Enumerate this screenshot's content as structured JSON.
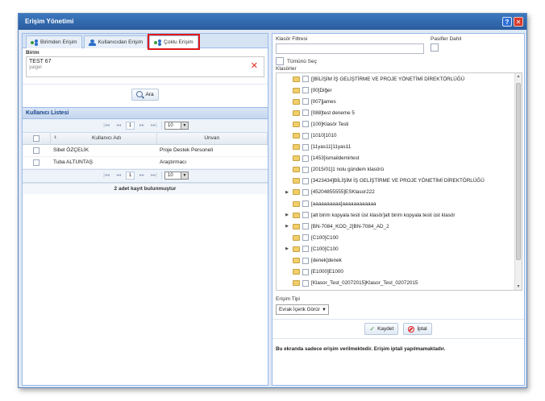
{
  "window": {
    "title": "Erişim Yönetimi"
  },
  "tabs": [
    {
      "label": "Birimden Erişim"
    },
    {
      "label": "Kullanıcıdan Erişim"
    },
    {
      "label": "Çoklu Erişim"
    }
  ],
  "birim": {
    "label": "Birim",
    "name": "TEST 67",
    "sub": "yaigel"
  },
  "search_button": {
    "label": "Ara"
  },
  "user_grid": {
    "title": "Kullanıcı Listesi",
    "page": "1",
    "page_size": "10",
    "columns": [
      "Kullanıcı Adı",
      "Unvan"
    ],
    "rows": [
      {
        "name": "Sibel ÖZÇELİK",
        "title": "Proje Destek Personeli"
      },
      {
        "name": "Tuba ALTUNTAŞ",
        "title": "Araştırmacı"
      }
    ],
    "footer": "2 adet kayıt bulunmuştur"
  },
  "right": {
    "filter_label": "Klasör Filtresi",
    "passive_label": "Pasifler Dahil",
    "select_all_label": "Tümünü Seç",
    "folders_label": "Klasörler",
    "access_type_label": "Erişim Tipi",
    "access_type_value": "Evrak İçerik Görür",
    "save_label": "Kaydet",
    "cancel_label": "İptal",
    "info": "Bu ekranda sadece erişim verilmektedir. Erişim iptali yapılmamaktadır."
  },
  "folders": [
    {
      "label": "[]BİLİŞİM İŞ GELİŞTİRME VE PROJE YÖNETİMİ DİREKTÖRLÜĞÜ",
      "expandable": false
    },
    {
      "label": "[00]Diğer",
      "expandable": false
    },
    {
      "label": "[007]james",
      "expandable": false
    },
    {
      "label": "[088]test deneme 5",
      "expandable": false
    },
    {
      "label": "[100]Klasör Testi",
      "expandable": false
    },
    {
      "label": "[1010]1010",
      "expandable": false
    },
    {
      "label": "[11yas11]11yas11",
      "expandable": false
    },
    {
      "label": "[1453]ismaildemirtest",
      "expandable": false
    },
    {
      "label": "[2015/01]1 nolu gündem klasörü",
      "expandable": false
    },
    {
      "label": "[3423434]BİLİŞİM İŞ GELİŞTİRME VE PROJE YÖNETİMİ DİREKTÖRLÜĞÜ",
      "expandable": false
    },
    {
      "label": "[45204855555]ESKlasor222",
      "expandable": true
    },
    {
      "label": "[aaaaaaaaaa]aaaaaaaaaaaa",
      "expandable": false
    },
    {
      "label": "[alt birim kopyala testi üst klasör]alt birim kopyala testi üst klasör",
      "expandable": true
    },
    {
      "label": "[BN-7084_KOD_2]BN-7084_AD_2",
      "expandable": true
    },
    {
      "label": "[C100]C100",
      "expandable": false
    },
    {
      "label": "[C100]C100",
      "expandable": true
    },
    {
      "label": "[denek]denek",
      "expandable": false
    },
    {
      "label": "[E1000]E1000",
      "expandable": false
    },
    {
      "label": "[Klasor_Test_02072015]Klasor_Test_02072015",
      "expandable": false
    }
  ]
}
